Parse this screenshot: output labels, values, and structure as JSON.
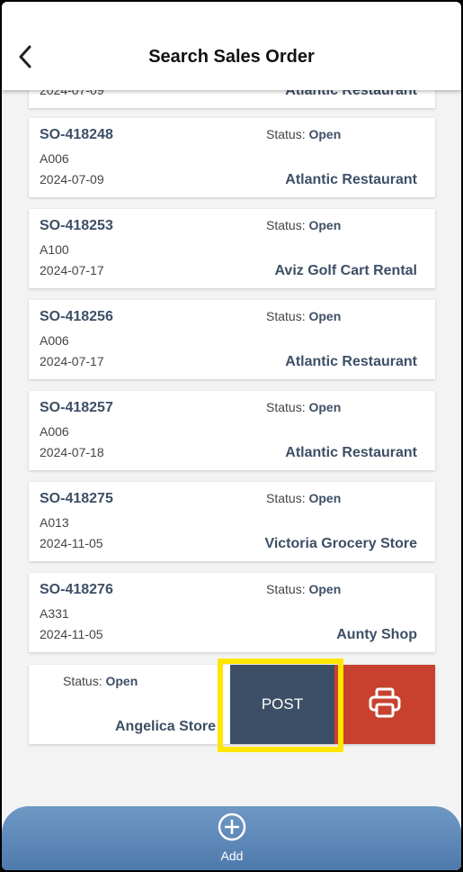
{
  "header": {
    "title": "Search Sales Order"
  },
  "partial_top_card": {
    "date": "2024-07-09",
    "customer": "Atlantic Restaurant"
  },
  "status_label": "Status:",
  "orders": [
    {
      "so": "SO-418248",
      "account": "A006",
      "date": "2024-07-09",
      "status": "Open",
      "customer": "Atlantic Restaurant"
    },
    {
      "so": "SO-418253",
      "account": "A100",
      "date": "2024-07-17",
      "status": "Open",
      "customer": "Aviz Golf Cart Rental"
    },
    {
      "so": "SO-418256",
      "account": "A006",
      "date": "2024-07-17",
      "status": "Open",
      "customer": "Atlantic Restaurant"
    },
    {
      "so": "SO-418257",
      "account": "A006",
      "date": "2024-07-18",
      "status": "Open",
      "customer": "Atlantic Restaurant"
    },
    {
      "so": "SO-418275",
      "account": "A013",
      "date": "2024-11-05",
      "status": "Open",
      "customer": "Victoria Grocery Store"
    },
    {
      "so": "SO-418276",
      "account": "A331",
      "date": "2024-11-05",
      "status": "Open",
      "customer": "Aunty Shop"
    }
  ],
  "swiped_card": {
    "status": "Open",
    "customer": "Angelica Store",
    "post_label": "POST",
    "print_icon": "printer-icon"
  },
  "bottom_bar": {
    "add_label": "Add",
    "add_icon": "plus-circle-icon"
  },
  "colors": {
    "primary": "#3d4f66",
    "print": "#c8412f",
    "highlight": "#ffe600",
    "bar": "#5b86b8"
  }
}
